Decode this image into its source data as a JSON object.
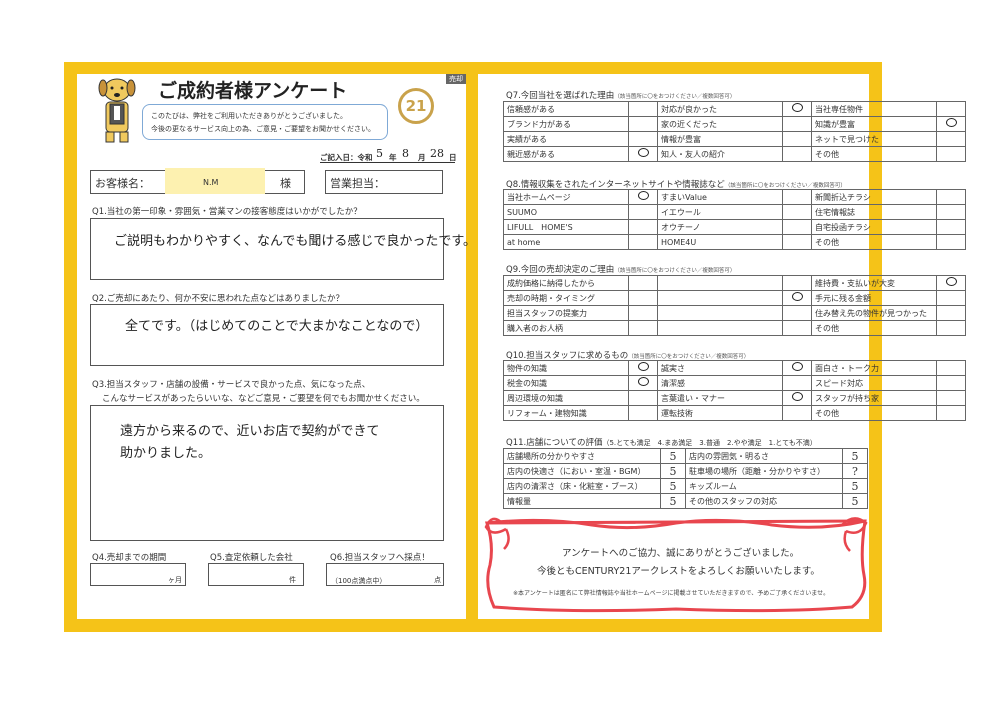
{
  "left": {
    "corner_tag": "売却",
    "title": "ご成約者様アンケート",
    "logo_text": "21",
    "bubble": [
      "このたびは、弊社をご利用いただきありがとうございました。",
      "今後の更なるサービス向上の為、ご意見・ご要望をお聞かせください。"
    ],
    "date": {
      "label": "ご記入日：令和",
      "year": "5",
      "year_unit": "年",
      "month": "8",
      "month_unit": "月",
      "day": "28",
      "day_unit": "日"
    },
    "customer": {
      "label": "お客様名：",
      "value": "N.M",
      "suffix": "様"
    },
    "sales_label": "営業担当：",
    "q1": {
      "question": "Q1.当社の第一印象・雰囲気・営業マンの接客態度はいかがでしたか？",
      "answer": "ご説明もわかりやすく、なんでも聞ける感じで良かったです。"
    },
    "q2": {
      "question": "Q2.ご売却にあたり、何か不安に思われた点などはありましたか？",
      "answer": "全てです。（はじめてのことで大まかなことなので）"
    },
    "q3": {
      "question": [
        "Q3.担当スタッフ・店舗の設備・サービスで良かった点、気になった点、",
        "こんなサービスがあったらいいな、などご意見・ご要望を何でもお聞かせください。"
      ],
      "answer": [
        "遠方から来るので、近いお店で契約ができて",
        "助かりました。"
      ]
    },
    "q4": {
      "label": "Q4.売却までの期間",
      "unit": "ヶ月"
    },
    "q5": {
      "label": "Q5.査定依頼した会社",
      "unit": "件"
    },
    "q6": {
      "label": "Q6.担当スタッフへ採点！",
      "hint": "（100点満点中）",
      "unit": "点"
    }
  },
  "right": {
    "q7": {
      "title": "Q7.今回当社を選ばれた理由",
      "note": "（該当箇所に〇をおつけください／複数回答可）",
      "rows": [
        [
          "信頼感がある",
          "",
          "対応が良かった",
          "○",
          "当社専任物件",
          ""
        ],
        [
          "ブランド力がある",
          "",
          "家の近くだった",
          "",
          "知識が豊富",
          "○"
        ],
        [
          "実績がある",
          "",
          "情報が豊富",
          "",
          "ネットで見つけた",
          ""
        ],
        [
          "親近感がある",
          "○",
          "知人・友人の紹介",
          "",
          "その他",
          ""
        ]
      ]
    },
    "q8": {
      "title": "Q8.情報収集をされたインターネットサイトや情報誌など",
      "note": "（該当箇所に〇をおつけください／複数回答可）",
      "rows": [
        [
          "当社ホームページ",
          "○",
          "すまいValue",
          "",
          "新聞折込チラシ",
          ""
        ],
        [
          "SUUMO",
          "",
          "イエウール",
          "",
          "住宅情報誌",
          ""
        ],
        [
          "LIFULL　HOME'S",
          "",
          "オウチーノ",
          "",
          "自宅投函チラシ",
          ""
        ],
        [
          "at home",
          "",
          "HOME4U",
          "",
          "その他",
          ""
        ]
      ]
    },
    "q9": {
      "title": "Q9.今回の売却決定のご理由",
      "note": "（該当箇所に〇をおつけください／複数回答可）",
      "rows": [
        [
          "成約価格に納得したから",
          "",
          "",
          "",
          "維持費・支払いが大変",
          "○"
        ],
        [
          "売却の時期・タイミング",
          "",
          "",
          "○",
          "手元に残る金額",
          ""
        ],
        [
          "担当スタッフの提案力",
          "",
          "",
          "",
          "住み替え先の物件が見つかった",
          ""
        ],
        [
          "購入者のお人柄",
          "",
          "",
          "",
          "その他",
          ""
        ]
      ]
    },
    "q10": {
      "title": "Q10.担当スタッフに求めるもの",
      "note": "（該当箇所に〇をおつけください／複数回答可）",
      "rows": [
        [
          "物件の知識",
          "○",
          "誠実さ",
          "○",
          "面白さ・トーク力",
          ""
        ],
        [
          "税金の知識",
          "○",
          "清潔感",
          "",
          "スピード対応",
          ""
        ],
        [
          "周辺環境の知識",
          "",
          "言葉遣い・マナー",
          "○",
          "スタッフが持ち家",
          ""
        ],
        [
          "リフォーム・建物知識",
          "",
          "運転技術",
          "",
          "その他",
          ""
        ]
      ]
    },
    "q11": {
      "title": "Q11.店舗についての評価",
      "scale": "（5.とても満足　4.まあ満足　3.普通　2.やや満足　1.とても不満）",
      "rows": [
        [
          "店舗場所の分かりやすさ",
          "5",
          "店内の雰囲気・明るさ",
          "5"
        ],
        [
          "店内の快適さ（におい・室温・BGM）",
          "5",
          "駐車場の場所（距離・分かりやすさ）",
          "?"
        ],
        [
          "店内の清潔さ（床・化粧室・ブース）",
          "5",
          "キッズルーム",
          "5"
        ],
        [
          "情報量",
          "5",
          "その他のスタッフの対応",
          "5"
        ]
      ]
    },
    "thanks": [
      "アンケートへのご協力、誠にありがとうございました。",
      "今後ともCENTURY21アークレストをよろしくお願いいたします。"
    ],
    "footnote": "※本アンケートは匿名にて弊社情報誌や当社ホームページに掲載させていただきますので、予めご了承くださいませ。",
    "ribbon_color": "#e8464e"
  },
  "colors": {
    "frame": "#f5c318",
    "highlight": "#fdf1b0",
    "bubble_border": "#7fa9d6",
    "logo_gold": "#c9a24b"
  }
}
